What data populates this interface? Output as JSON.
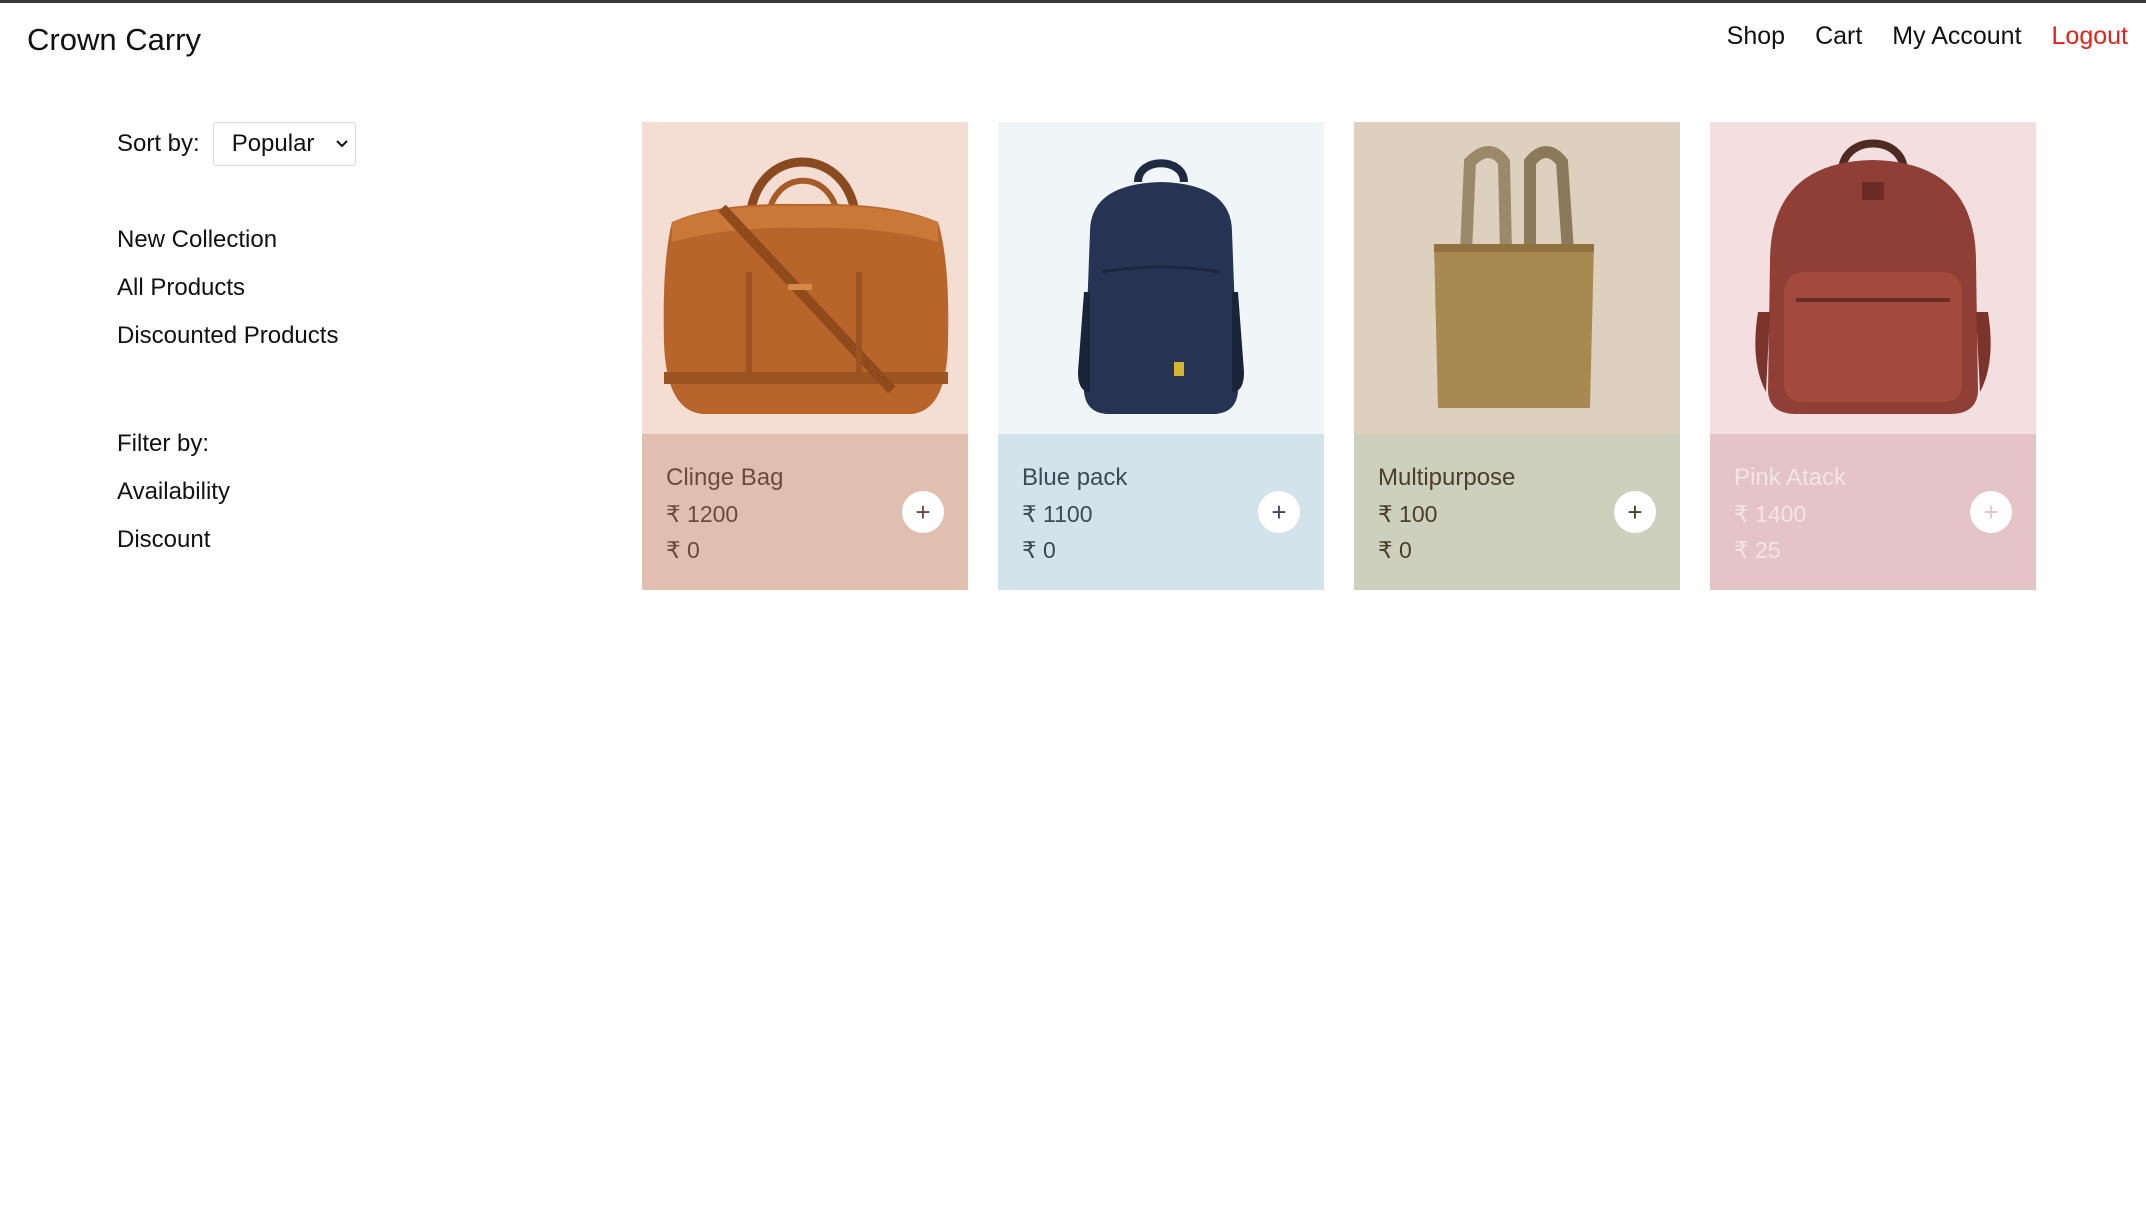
{
  "header": {
    "brand": "Crown Carry",
    "nav": [
      {
        "label": "Shop"
      },
      {
        "label": "Cart"
      },
      {
        "label": "My Account"
      },
      {
        "label": "Logout",
        "color": "#e3201b"
      }
    ]
  },
  "sidebar": {
    "sort_label": "Sort by:",
    "sort_value": "Popular",
    "menu": [
      "New Collection",
      "All Products",
      "Discounted Products"
    ],
    "filter_title": "Filter by:",
    "filters": [
      "Availability",
      "Discount"
    ]
  },
  "products": [
    {
      "name": "Clinge Bag",
      "price": "₹ 1200",
      "discount": "₹ 0",
      "image": "duffle-bag-image",
      "image_bg": "#f4ddd3",
      "info_bg": "#e0bfb0",
      "text_color": "#6b4b3e"
    },
    {
      "name": "Blue pack",
      "price": "₹ 1100",
      "discount": "₹ 0",
      "image": "blue-backpack-image",
      "image_bg": "#f0f5f8",
      "info_bg": "#d3e3ec",
      "text_color": "#3c4a55"
    },
    {
      "name": "Multipurpose",
      "price": "₹ 100",
      "discount": "₹ 0",
      "image": "tote-bag-image",
      "image_bg": "#ddd0bf",
      "info_bg": "#ced0be",
      "text_color": "#4a3f28"
    },
    {
      "name": "Pink Atack",
      "price": "₹ 1400",
      "discount": "₹ 25",
      "image": "leather-backpack-image",
      "image_bg": "#f3dfe0",
      "info_bg": "#e5c4c7",
      "text_color": "#ffffff"
    }
  ],
  "icons": {
    "add": "plus-icon",
    "sort_chevron": "chevron-down-icon"
  }
}
